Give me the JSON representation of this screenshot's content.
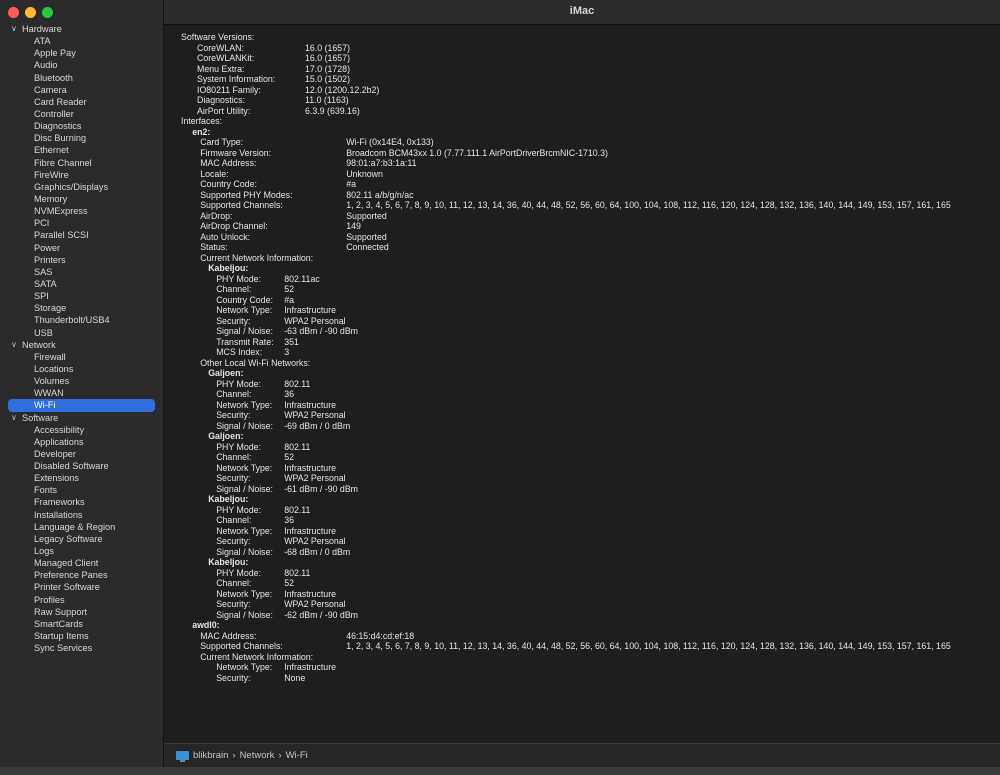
{
  "window": {
    "title": "iMac"
  },
  "sidebar": {
    "groups": [
      {
        "label": "Hardware",
        "items": [
          "ATA",
          "Apple Pay",
          "Audio",
          "Bluetooth",
          "Camera",
          "Card Reader",
          "Controller",
          "Diagnostics",
          "Disc Burning",
          "Ethernet",
          "Fibre Channel",
          "FireWire",
          "Graphics/Displays",
          "Memory",
          "NVMExpress",
          "PCI",
          "Parallel SCSI",
          "Power",
          "Printers",
          "SAS",
          "SATA",
          "SPI",
          "Storage",
          "Thunderbolt/USB4",
          "USB"
        ]
      },
      {
        "label": "Network",
        "items": [
          "Firewall",
          "Locations",
          "Volumes",
          "WWAN",
          "Wi-Fi"
        ]
      },
      {
        "label": "Software",
        "items": [
          "Accessibility",
          "Applications",
          "Developer",
          "Disabled Software",
          "Extensions",
          "Fonts",
          "Frameworks",
          "Installations",
          "Language & Region",
          "Legacy Software",
          "Logs",
          "Managed Client",
          "Preference Panes",
          "Printer Software",
          "Profiles",
          "Raw Support",
          "SmartCards",
          "Startup Items",
          "Sync Services"
        ]
      }
    ],
    "selected": "Wi-Fi"
  },
  "report": [
    {
      "ind": 0,
      "k": "Software Versions:",
      "v": ""
    },
    {
      "ind": 1,
      "k": "CoreWLAN:",
      "v": "16.0 (1657)",
      "vx": 108
    },
    {
      "ind": 1,
      "k": "CoreWLANKit:",
      "v": "16.0 (1657)",
      "vx": 108
    },
    {
      "ind": 1,
      "k": "Menu Extra:",
      "v": "17.0 (1728)",
      "vx": 108
    },
    {
      "ind": 1,
      "k": "System Information:",
      "v": "15.0 (1502)",
      "vx": 108
    },
    {
      "ind": 1,
      "k": "IO80211 Family:",
      "v": "12.0 (1200.12.2b2)",
      "vx": 108
    },
    {
      "ind": 1,
      "k": "Diagnostics:",
      "v": "11.0 (1163)",
      "vx": 108
    },
    {
      "ind": 1,
      "k": "AirPort Utility:",
      "v": "6.3.9 (639.16)",
      "vx": 108
    },
    {
      "ind": 0,
      "k": "Interfaces:",
      "v": ""
    },
    {
      "ind": 0.7,
      "k": "en2:",
      "v": "",
      "bold": true
    },
    {
      "ind": 1.2,
      "k": "Card Type:",
      "v": "Wi-Fi  (0x14E4, 0x133)",
      "vx": 146
    },
    {
      "ind": 1.2,
      "k": "Firmware Version:",
      "v": "Broadcom BCM43xx 1.0 (7.77.111.1 AirPortDriverBrcmNIC-1710.3)",
      "vx": 146
    },
    {
      "ind": 1.2,
      "k": "MAC Address:",
      "v": "98:01:a7:b3:1a:11",
      "vx": 146
    },
    {
      "ind": 1.2,
      "k": "Locale:",
      "v": "Unknown",
      "vx": 146
    },
    {
      "ind": 1.2,
      "k": "Country Code:",
      "v": "#a",
      "vx": 146
    },
    {
      "ind": 1.2,
      "k": "Supported PHY Modes:",
      "v": "802.11 a/b/g/n/ac",
      "vx": 146
    },
    {
      "ind": 1.2,
      "k": "Supported Channels:",
      "v": "1, 2, 3, 4, 5, 6, 7, 8, 9, 10, 11, 12, 13, 14, 36, 40, 44, 48, 52, 56, 60, 64, 100, 104, 108, 112, 116, 120, 124, 128, 132, 136, 140, 144, 149, 153, 157, 161, 165",
      "vx": 146
    },
    {
      "ind": 1.2,
      "k": "AirDrop:",
      "v": "Supported",
      "vx": 146
    },
    {
      "ind": 1.2,
      "k": "AirDrop Channel:",
      "v": "149",
      "vx": 146
    },
    {
      "ind": 1.2,
      "k": "Auto Unlock:",
      "v": "Supported",
      "vx": 146
    },
    {
      "ind": 1.2,
      "k": "Status:",
      "v": "Connected",
      "vx": 146
    },
    {
      "ind": 1.2,
      "k": "Current Network Information:",
      "v": ""
    },
    {
      "ind": 1.7,
      "k": "Kabeljou:",
      "v": "",
      "bold": true
    },
    {
      "ind": 2.2,
      "k": "PHY Mode:",
      "v": "802.11ac",
      "vx": 68
    },
    {
      "ind": 2.2,
      "k": "Channel:",
      "v": "52",
      "vx": 68
    },
    {
      "ind": 2.2,
      "k": "Country Code:",
      "v": "#a",
      "vx": 68
    },
    {
      "ind": 2.2,
      "k": "Network Type:",
      "v": "Infrastructure",
      "vx": 68
    },
    {
      "ind": 2.2,
      "k": "Security:",
      "v": "WPA2 Personal",
      "vx": 68
    },
    {
      "ind": 2.2,
      "k": "Signal / Noise:",
      "v": "-63 dBm / -90 dBm",
      "vx": 68
    },
    {
      "ind": 2.2,
      "k": "Transmit Rate:",
      "v": "351",
      "vx": 68
    },
    {
      "ind": 2.2,
      "k": "MCS Index:",
      "v": "3",
      "vx": 68
    },
    {
      "ind": 1.2,
      "k": "Other Local Wi-Fi Networks:",
      "v": ""
    },
    {
      "ind": 1.7,
      "k": "Galjoen:",
      "v": "",
      "bold": true
    },
    {
      "ind": 2.2,
      "k": "PHY Mode:",
      "v": "802.11",
      "vx": 68
    },
    {
      "ind": 2.2,
      "k": "Channel:",
      "v": "36",
      "vx": 68
    },
    {
      "ind": 2.2,
      "k": "Network Type:",
      "v": "Infrastructure",
      "vx": 68
    },
    {
      "ind": 2.2,
      "k": "Security:",
      "v": "WPA2 Personal",
      "vx": 68
    },
    {
      "ind": 2.2,
      "k": "Signal / Noise:",
      "v": "-69 dBm / 0 dBm",
      "vx": 68
    },
    {
      "ind": 1.7,
      "k": "Galjoen:",
      "v": "",
      "bold": true
    },
    {
      "ind": 2.2,
      "k": "PHY Mode:",
      "v": "802.11",
      "vx": 68
    },
    {
      "ind": 2.2,
      "k": "Channel:",
      "v": "52",
      "vx": 68
    },
    {
      "ind": 2.2,
      "k": "Network Type:",
      "v": "Infrastructure",
      "vx": 68
    },
    {
      "ind": 2.2,
      "k": "Security:",
      "v": "WPA2 Personal",
      "vx": 68
    },
    {
      "ind": 2.2,
      "k": "Signal / Noise:",
      "v": "-61 dBm / -90 dBm",
      "vx": 68
    },
    {
      "ind": 1.7,
      "k": "Kabeljou:",
      "v": "",
      "bold": true
    },
    {
      "ind": 2.2,
      "k": "PHY Mode:",
      "v": "802.11",
      "vx": 68
    },
    {
      "ind": 2.2,
      "k": "Channel:",
      "v": "36",
      "vx": 68
    },
    {
      "ind": 2.2,
      "k": "Network Type:",
      "v": "Infrastructure",
      "vx": 68
    },
    {
      "ind": 2.2,
      "k": "Security:",
      "v": "WPA2 Personal",
      "vx": 68
    },
    {
      "ind": 2.2,
      "k": "Signal / Noise:",
      "v": "-68 dBm / 0 dBm",
      "vx": 68
    },
    {
      "ind": 1.7,
      "k": "Kabeljou:",
      "v": "",
      "bold": true
    },
    {
      "ind": 2.2,
      "k": "PHY Mode:",
      "v": "802.11",
      "vx": 68
    },
    {
      "ind": 2.2,
      "k": "Channel:",
      "v": "52",
      "vx": 68
    },
    {
      "ind": 2.2,
      "k": "Network Type:",
      "v": "Infrastructure",
      "vx": 68
    },
    {
      "ind": 2.2,
      "k": "Security:",
      "v": "WPA2 Personal",
      "vx": 68
    },
    {
      "ind": 2.2,
      "k": "Signal / Noise:",
      "v": "-62 dBm / -90 dBm",
      "vx": 68
    },
    {
      "ind": 0.7,
      "k": "awdl0:",
      "v": "",
      "bold": true
    },
    {
      "ind": 1.2,
      "k": "MAC Address:",
      "v": "46:15:d4:cd:ef:18",
      "vx": 146
    },
    {
      "ind": 1.2,
      "k": "Supported Channels:",
      "v": "1, 2, 3, 4, 5, 6, 7, 8, 9, 10, 11, 12, 13, 14, 36, 40, 44, 48, 52, 56, 60, 64, 100, 104, 108, 112, 116, 120, 124, 128, 132, 136, 140, 144, 149, 153, 157, 161, 165",
      "vx": 146
    },
    {
      "ind": 1.2,
      "k": "Current Network Information:",
      "v": ""
    },
    {
      "ind": 2.2,
      "k": "Network Type:",
      "v": "Infrastructure",
      "vx": 68
    },
    {
      "ind": 2.2,
      "k": "Security:",
      "v": "None",
      "vx": 68
    }
  ],
  "statusbar": {
    "crumbs": [
      "blikbrain",
      "Network",
      "Wi-Fi"
    ],
    "separator": "›",
    "icon": "imac-icon"
  }
}
